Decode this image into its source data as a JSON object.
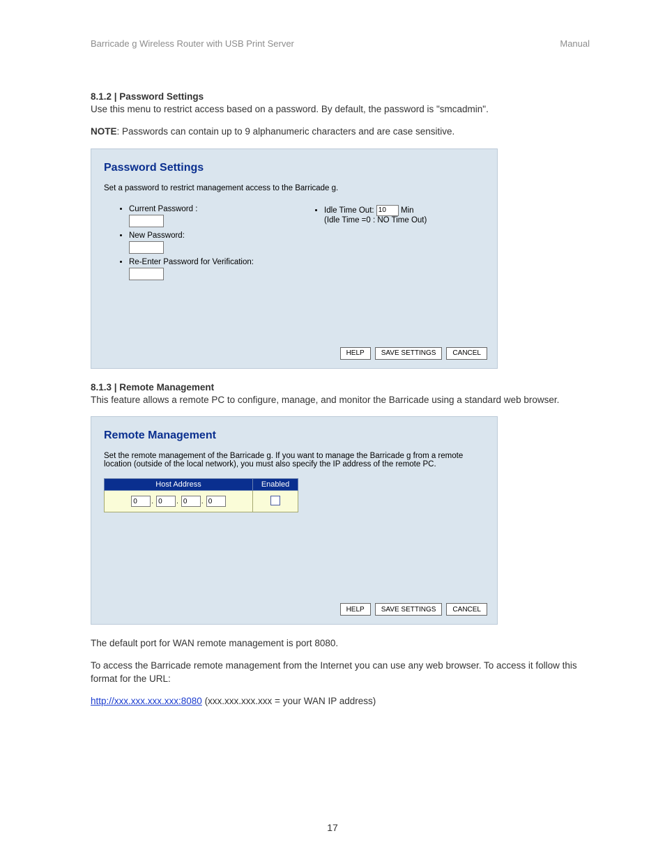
{
  "header": {
    "product": "Barricade g Wireless Router with USB Print Server",
    "doc_type": "Manual"
  },
  "sections": {
    "s812": {
      "heading": "8.1.2 | Password Settings",
      "intro": "Use this menu to restrict access based on a password. By default, the password is \"smcadmin\".",
      "note_label": "NOTE",
      "note_body": ": Passwords can contain up to 9 alphanumeric characters and are case sensitive."
    },
    "s813": {
      "heading": "8.1.3 | Remote Management",
      "intro": "This feature allows a remote PC to configure, manage, and monitor the Barricade using a standard web browser.",
      "after1": "The default port for WAN remote management is port 8080.",
      "after2": "To access the Barricade remote management from the Internet you can use any web browser. To access it follow this format for the URL:",
      "url": "http://xxx.xxx.xxx.xxx:8080",
      "url_explain": "   (xxx.xxx.xxx.xxx = your WAN IP address)"
    }
  },
  "panel1": {
    "title": "Password Settings",
    "desc": "Set a password to restrict management access to the Barricade g.",
    "fields": {
      "current": "Current Password :",
      "newpw": "New Password:",
      "reenter": "Re-Enter Password for Verification:",
      "idle_label_pre": "Idle Time Out: ",
      "idle_value": "10",
      "idle_label_post": " Min",
      "idle_note": "(Idle Time =0 : NO Time Out)"
    }
  },
  "panel2": {
    "title": "Remote Management",
    "desc": "Set the remote management of the Barricade g. If you want to manage the Barricade g from a remote location (outside of the local network), you must also specify the IP address of the remote PC.",
    "th_host": "Host Address",
    "th_enabled": "Enabled",
    "octet": "0"
  },
  "buttons": {
    "help": "HELP",
    "save": "SAVE SETTINGS",
    "cancel": "CANCEL"
  },
  "page_number": "17"
}
